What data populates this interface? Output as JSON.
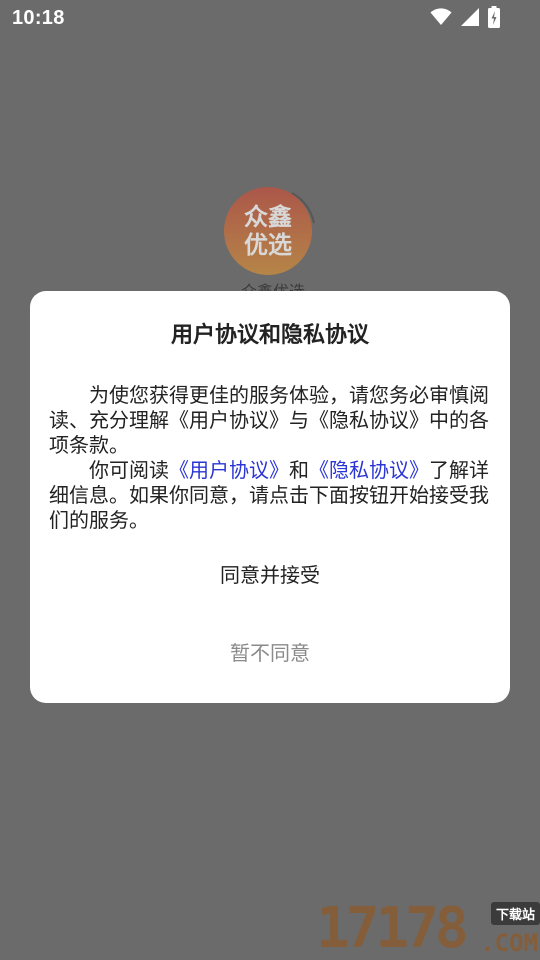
{
  "status_bar": {
    "time": "10:18",
    "icons": [
      "wifi-icon",
      "signal-icon",
      "battery-charging-icon"
    ]
  },
  "app": {
    "logo_lines": [
      "众鑫",
      "优选"
    ],
    "name_peek": "众鑫优选"
  },
  "dialog": {
    "title": "用户协议和隐私协议",
    "paragraph1": "为使您获得更佳的服务体验，请您务必审慎阅读、充分理解《用户协议》与《隐私协议》中的各项条款。",
    "paragraph2": {
      "prefix": "你可阅读",
      "link_user_agreement": "《用户协议》",
      "middle": "和",
      "link_privacy_agreement": "《隐私协议》",
      "suffix": "了解详细信息。如果你同意，请点击下面按钮开始接受我们的服务。"
    },
    "agree_label": "同意并接受",
    "decline_label": "暂不同意"
  },
  "watermark": {
    "digits": "17178",
    "badge": "下载站",
    "domain": ".COM"
  },
  "colors": {
    "overlay_background": "#6b6b6b",
    "dialog_background": "#ffffff",
    "link": "#2b35d4",
    "decline_text": "#8a8a8a",
    "logo_gradient_top": "#e0452e",
    "logo_gradient_bottom": "#f29a2a"
  }
}
